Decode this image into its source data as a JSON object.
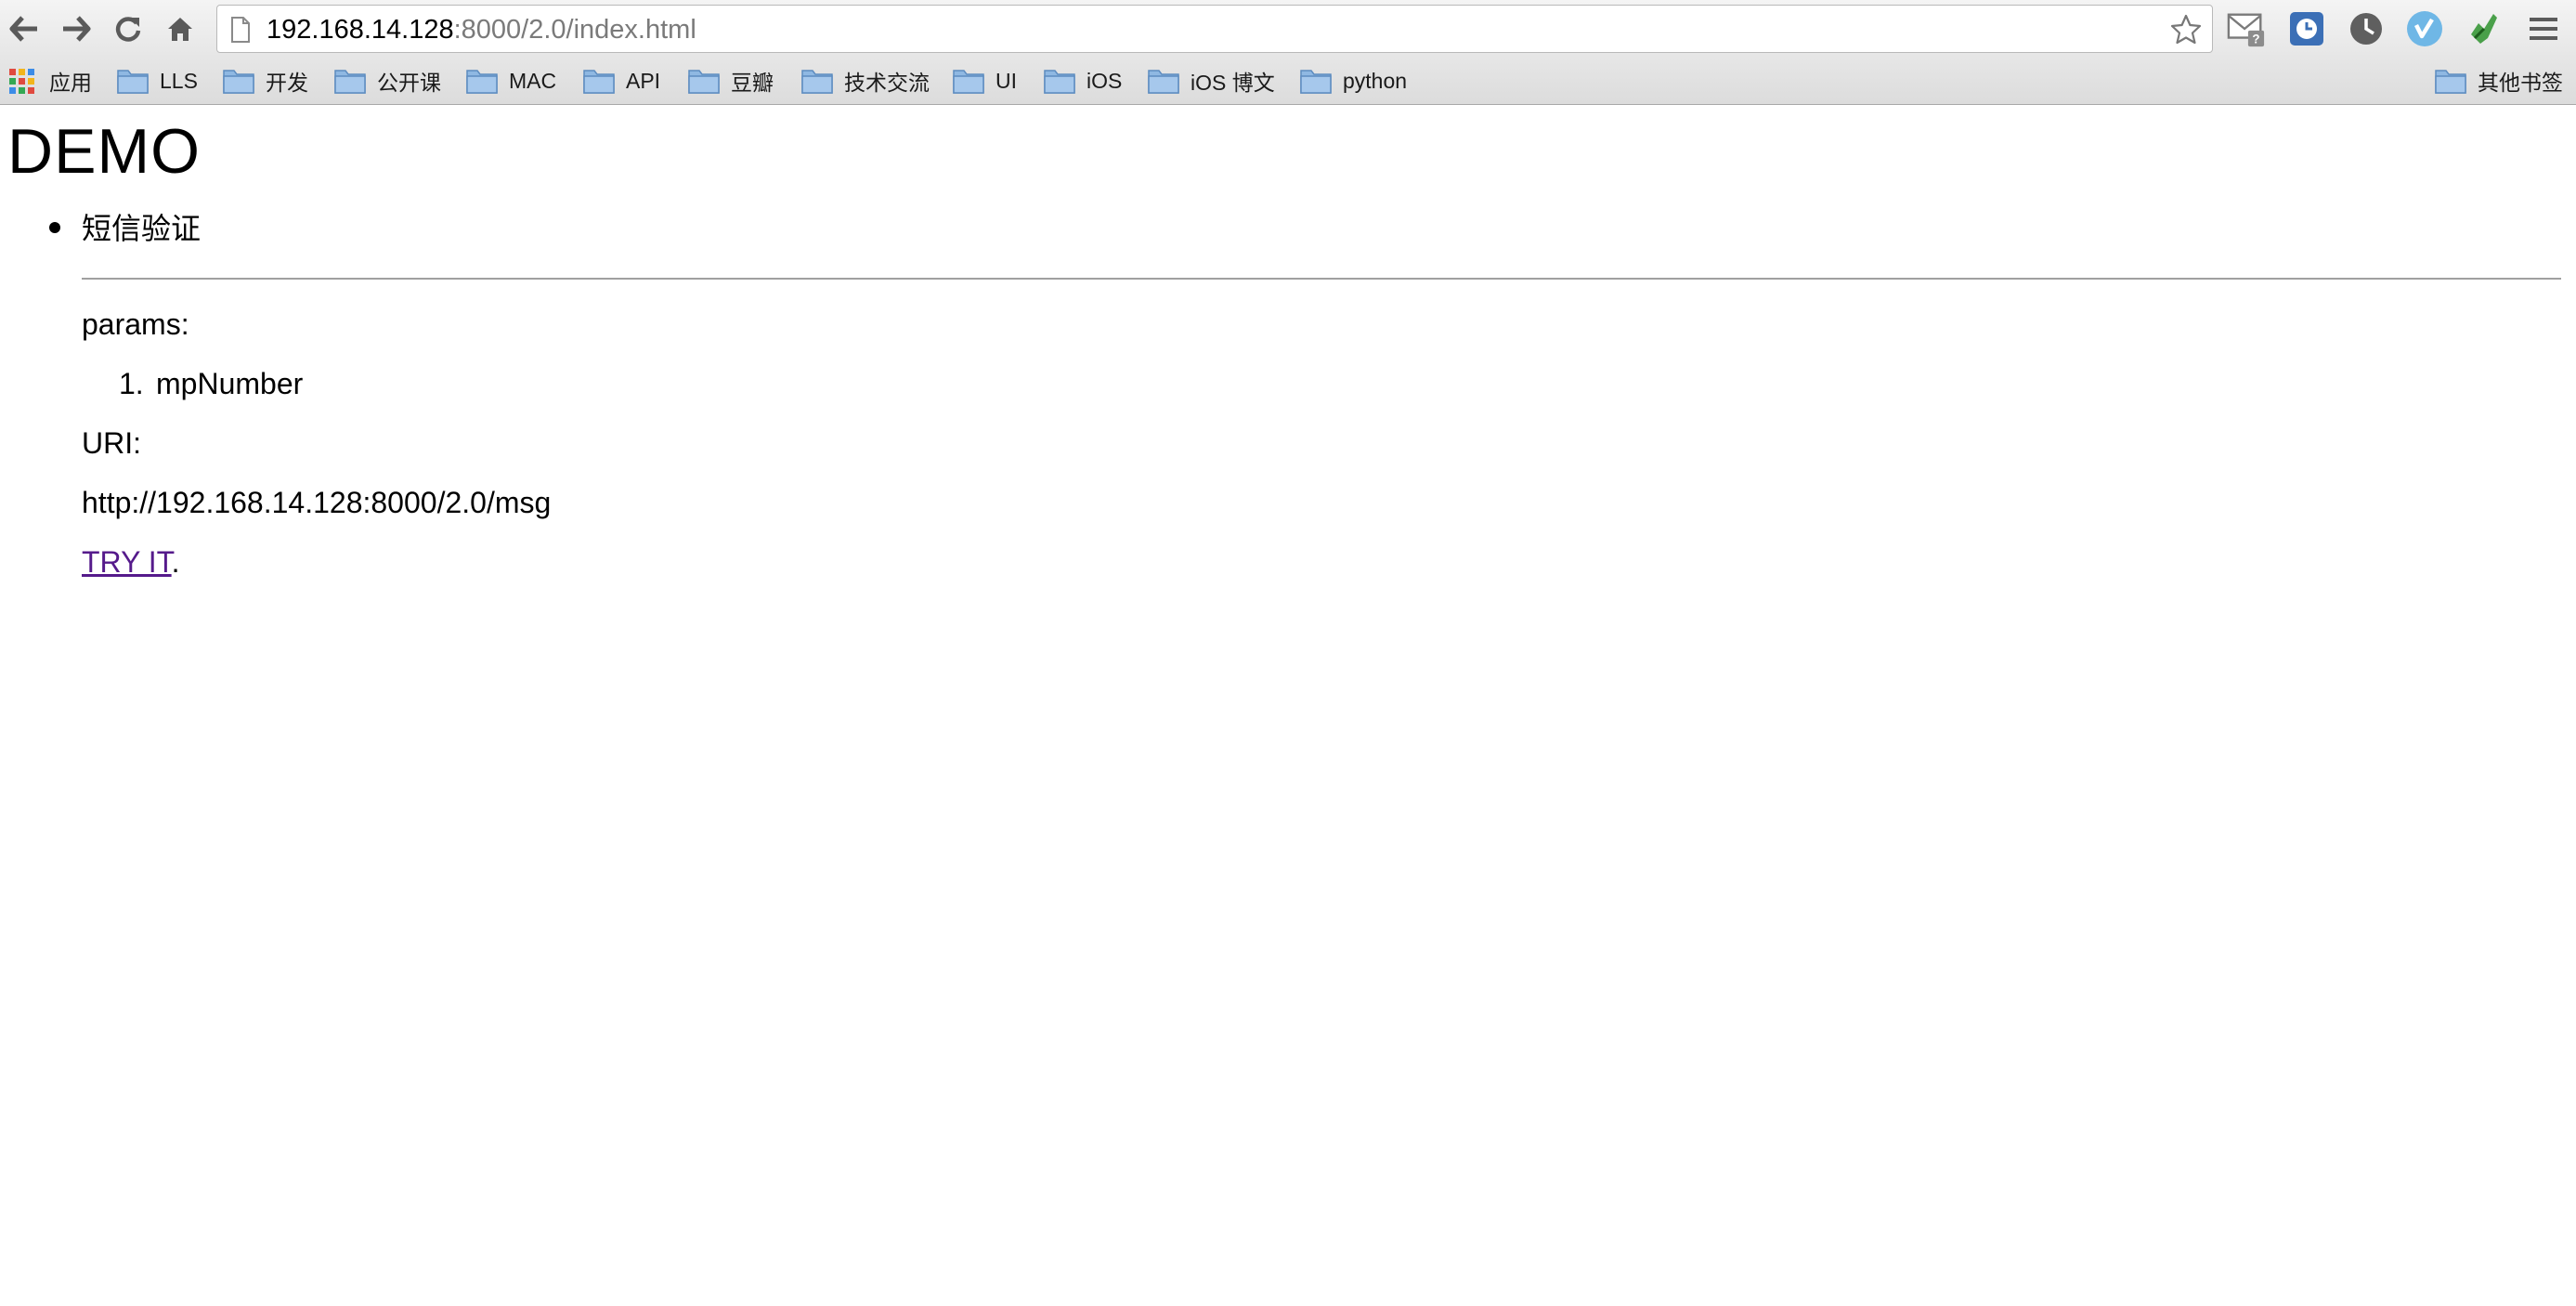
{
  "browser": {
    "url_host": "192.168.14.128",
    "url_rest": ":8000/2.0/index.html",
    "icons": [
      "back-arrow-icon",
      "forward-arrow-icon",
      "reload-icon",
      "home-icon",
      "page-icon",
      "bookmark-star-icon",
      "gmail-checker-icon",
      "timer-extension-icon",
      "history-clock-icon",
      "vimeo-extension-icon",
      "evernote-extension-icon",
      "chrome-menu-icon"
    ]
  },
  "bookmarks": {
    "apps_label": "应用",
    "items": [
      {
        "label": "LLS"
      },
      {
        "label": "开发"
      },
      {
        "label": "公开课"
      },
      {
        "label": "MAC"
      },
      {
        "label": "API"
      },
      {
        "label": "豆瓣"
      },
      {
        "label": "技术交流"
      },
      {
        "label": "UI"
      },
      {
        "label": "iOS"
      },
      {
        "label": "iOS 博文"
      },
      {
        "label": "python"
      }
    ],
    "other_label": "其他书签"
  },
  "page": {
    "title": "DEMO",
    "section": {
      "name": "短信验证",
      "params_label": "params:",
      "params": [
        {
          "number": "1.",
          "name": "mpNumber"
        }
      ],
      "uri_label": "URI:",
      "uri": "http://192.168.14.128:8000/2.0/msg",
      "link_text": "TRY IT",
      "link_suffix": "."
    }
  },
  "colors": {
    "link_visited": "#551a8b",
    "folder_blue": "#7aa8d6",
    "rule_gray": "#a0a0a0"
  }
}
